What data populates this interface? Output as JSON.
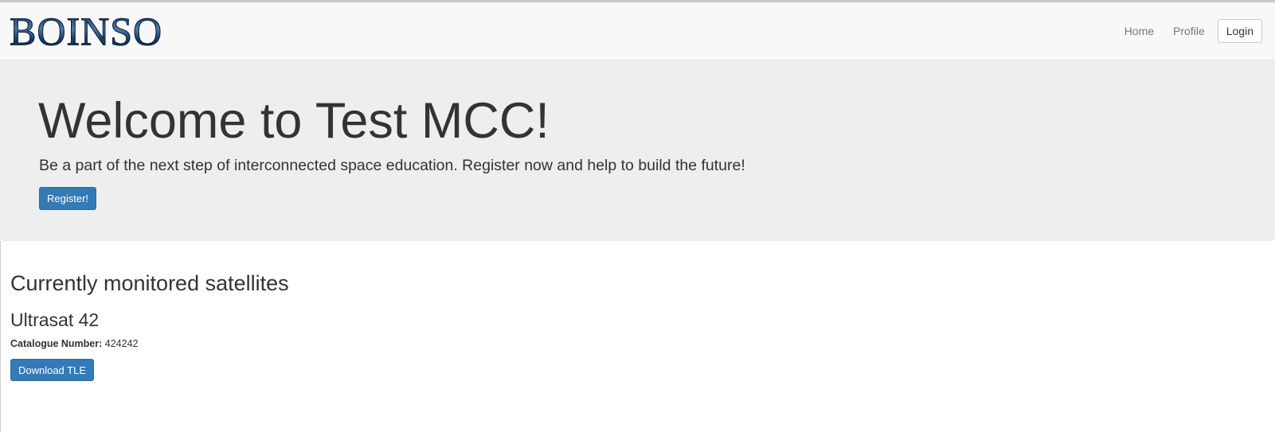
{
  "navbar": {
    "brand": "BOINSO",
    "links": [
      {
        "label": "Home"
      },
      {
        "label": "Profile"
      }
    ],
    "login_label": "Login"
  },
  "hero": {
    "title": "Welcome to Test MCC!",
    "lead": "Be a part of the next step of interconnected space education. Register now and help to build the future!",
    "register_label": "Register!"
  },
  "satellites": {
    "heading": "Currently monitored satellites",
    "items": [
      {
        "name": "Ultrasat 42",
        "catalogue_label": "Catalogue Number:",
        "catalogue_number": "424242",
        "download_label": "Download TLE"
      }
    ]
  },
  "colors": {
    "primary": "#337ab7",
    "navbar_bg": "#f8f8f8",
    "jumbotron_bg": "#eeeeee"
  }
}
